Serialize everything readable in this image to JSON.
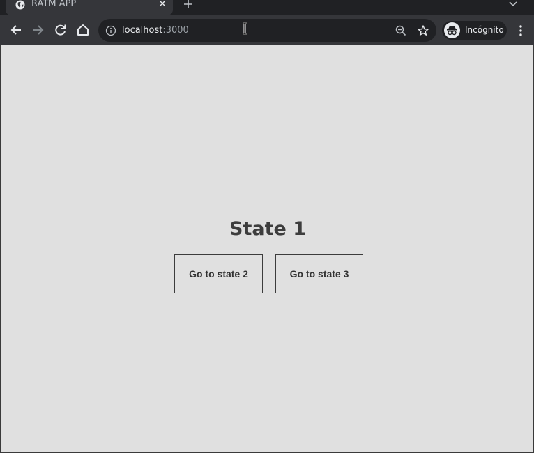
{
  "browser": {
    "tab": {
      "title": "RATM APP"
    },
    "address": {
      "host": "localhost",
      "port": ":3000"
    },
    "profile": {
      "label": "Incógnito"
    },
    "icons": {
      "favicon": "globe-icon",
      "tab_close": "close-icon",
      "new_tab": "plus-icon",
      "tab_search": "chevron-down-icon",
      "back": "arrow-left-icon",
      "forward": "arrow-right-icon",
      "reload": "reload-icon",
      "home": "home-icon",
      "site_info": "info-icon",
      "zoom": "zoom-out-icon",
      "bookmark": "star-icon",
      "incognito": "incognito-icon",
      "menu": "kebab-menu-icon"
    },
    "colors": {
      "frame": "#202124",
      "toolbar": "#35363a",
      "page_bg": "#e0e0e0",
      "text": "#3d3d3d"
    }
  },
  "page": {
    "heading": "State 1",
    "buttons": [
      {
        "label": "Go to state 2"
      },
      {
        "label": "Go to state 3"
      }
    ]
  }
}
